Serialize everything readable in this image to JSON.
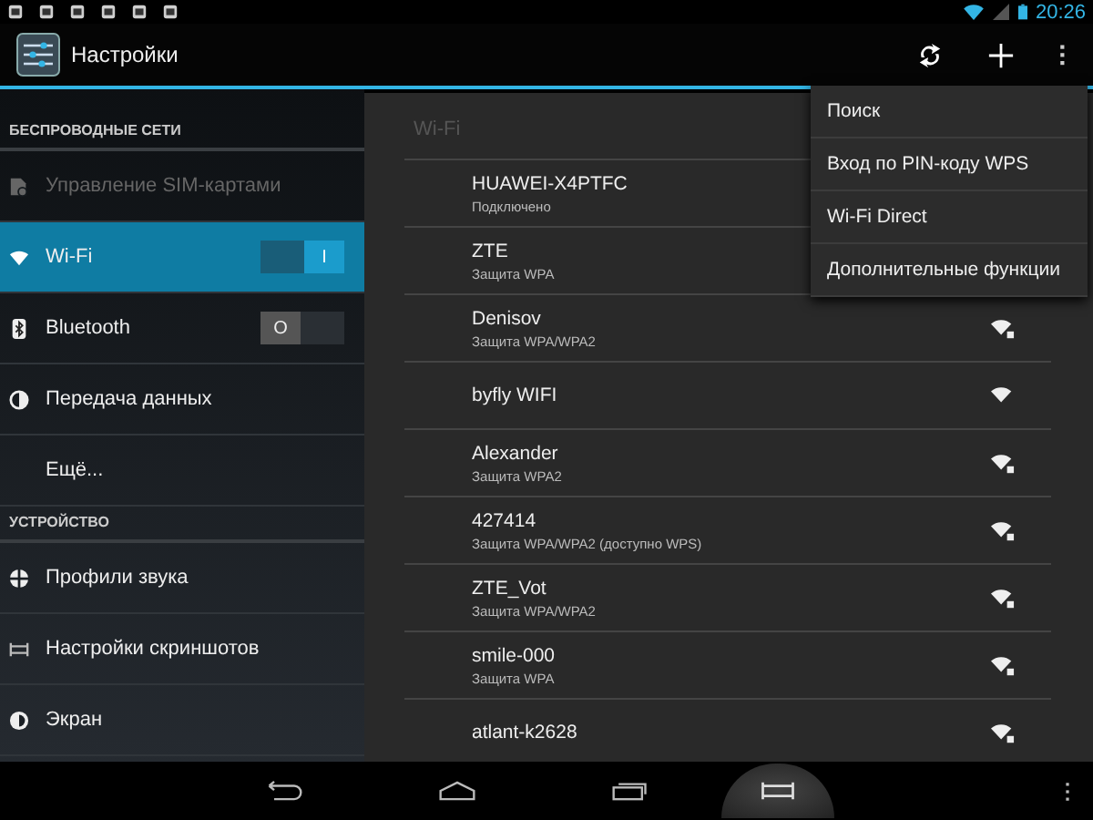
{
  "status_bar": {
    "time": "20:26"
  },
  "action_bar": {
    "title": "Настройки"
  },
  "sidebar": {
    "sections": [
      {
        "header": "БЕСПРОВОДНЫЕ СЕТИ",
        "items": [
          {
            "label": "Управление SIM-картами",
            "kind": "sim",
            "selected": false,
            "disabled": true
          },
          {
            "label": "Wi-Fi",
            "kind": "wifi",
            "selected": true,
            "disabled": false,
            "toggle": {
              "on": true,
              "text": "I"
            }
          },
          {
            "label": "Bluetooth",
            "kind": "bluetooth",
            "selected": false,
            "disabled": false,
            "toggle": {
              "on": false,
              "text": "O"
            }
          },
          {
            "label": "Передача данных",
            "kind": "data",
            "selected": false,
            "disabled": false
          },
          {
            "label": "Ещё...",
            "kind": "plain",
            "selected": false,
            "disabled": false
          }
        ]
      },
      {
        "header": "УСТРОЙСТВО",
        "items": [
          {
            "label": "Профили звука",
            "kind": "sound",
            "selected": false,
            "disabled": false
          },
          {
            "label": "Настройки скриншотов",
            "kind": "screenshot",
            "selected": false,
            "disabled": false
          },
          {
            "label": "Экран",
            "kind": "display",
            "selected": false,
            "disabled": false
          }
        ]
      }
    ]
  },
  "wifi_panel": {
    "title": "Wi-Fi",
    "networks": [
      {
        "name": "HUAWEI-X4PTFC",
        "status": "Подключено",
        "kind": "covered"
      },
      {
        "name": "ZTE",
        "status": "Защита WPA",
        "kind": "covered"
      },
      {
        "name": "Denisov",
        "status": "Защита WPA/WPA2",
        "kind": "secured"
      },
      {
        "name": "byfly WIFI",
        "kind": "open"
      },
      {
        "name": "Alexander",
        "status": "Защита WPA2",
        "kind": "secured"
      },
      {
        "name": "427414",
        "status": "Защита WPA/WPA2 (доступно WPS)",
        "kind": "secured"
      },
      {
        "name": "ZTE_Vot",
        "status": "Защита WPA/WPA2",
        "kind": "secured"
      },
      {
        "name": "smile-000",
        "status": "Защита WPA",
        "kind": "secured"
      },
      {
        "name": "atlant-k2628",
        "kind": "secured"
      }
    ]
  },
  "overflow_menu": {
    "items": [
      "Поиск",
      "Вход по PIN-коду WPS",
      "Wi-Fi Direct",
      "Дополнительные функции"
    ]
  }
}
